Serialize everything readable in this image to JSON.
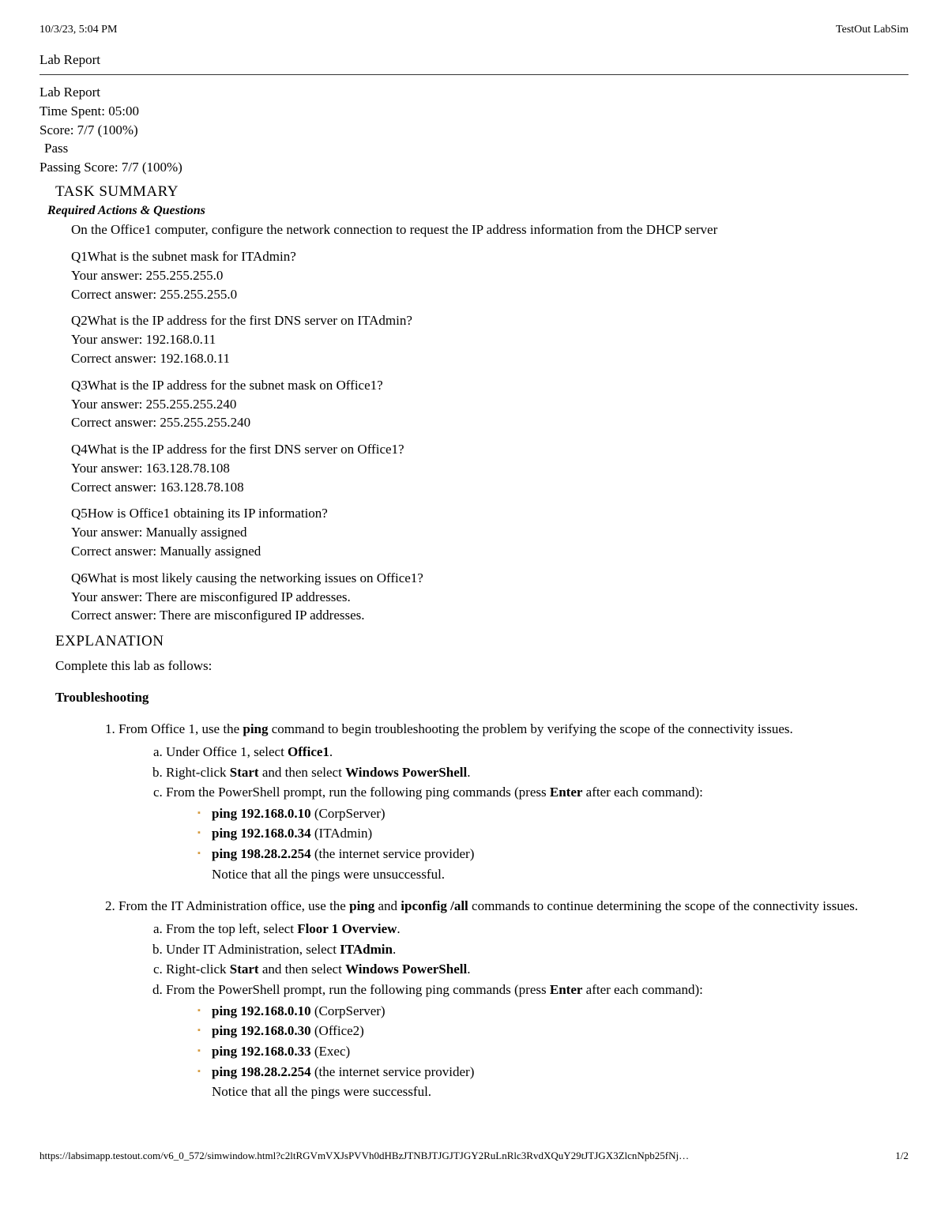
{
  "header": {
    "datetime": "10/3/23, 5:04 PM",
    "app_title": "TestOut LabSim"
  },
  "title": "Lab Report",
  "summary": {
    "title": "Lab Report",
    "time_spent": "Time Spent: 05:00",
    "score": "Score: 7/7 (100%)",
    "status": "Pass",
    "passing_score": "Passing Score: 7/7 (100%)"
  },
  "task_summary_title": "TASK SUMMARY",
  "required_title": "Required Actions & Questions",
  "action1": "On the Office1 computer, configure the network connection to request the IP address information from the DHCP server",
  "questions": [
    {
      "q": "Q1What is the subnet mask for ITAdmin?",
      "your": "Your answer: 255.255.255.0",
      "correct": "Correct answer: 255.255.255.0"
    },
    {
      "q": "Q2What is the IP address for the first DNS server on ITAdmin?",
      "your": "Your answer: 192.168.0.11",
      "correct": "Correct answer: 192.168.0.11"
    },
    {
      "q": "Q3What is the IP address for the subnet mask on Office1?",
      "your": "Your answer: 255.255.255.240",
      "correct": "Correct answer: 255.255.255.240"
    },
    {
      "q": "Q4What is the IP address for the first DNS server on Office1?",
      "your": "Your answer: 163.128.78.108",
      "correct": "Correct answer: 163.128.78.108"
    },
    {
      "q": "Q5How is Office1 obtaining its IP information?",
      "your": "Your answer: Manually assigned",
      "correct": "Correct answer: Manually assigned"
    },
    {
      "q": "Q6What is most likely causing the networking issues on Office1?",
      "your": "Your answer: There are misconfigured IP addresses.",
      "correct": "Correct answer: There are misconfigured IP addresses."
    }
  ],
  "explanation_title": "EXPLANATION",
  "explanation_intro": "Complete this lab as follows:",
  "troubleshooting_title": "Troubleshooting",
  "step1": {
    "text_pre": "From Office 1, use the ",
    "bold1": "ping",
    "text_post": " command to begin troubleshooting the problem by verifying the scope of the connectivity issues.",
    "a_pre": "Under Office 1, select ",
    "a_bold": "Office1",
    "a_post": ".",
    "b_pre": "Right-click ",
    "b_bold1": "Start",
    "b_mid": " and then select ",
    "b_bold2": "Windows PowerShell",
    "b_post": ".",
    "c_pre": "From the PowerShell prompt, run the following ping commands (press ",
    "c_bold": "Enter",
    "c_post": " after each command):",
    "bullet1_bold": "ping 192.168.0.10",
    "bullet1_post": " (CorpServer)",
    "bullet2_bold": "ping 192.168.0.34",
    "bullet2_post": " (ITAdmin)",
    "bullet3_bold": "ping 198.28.2.254",
    "bullet3_post": " (the internet service provider)",
    "note": "Notice that all the pings were unsuccessful."
  },
  "step2": {
    "text_pre": "From the IT Administration office, use the ",
    "bold1": "ping",
    "text_mid": " and ",
    "bold2": "ipconfig /all",
    "text_post": " commands to continue determining the scope of the connectivity issues.",
    "a_pre": "From the top left, select ",
    "a_bold": "Floor 1 Overview",
    "a_post": ".",
    "b_pre": "Under IT Administration, select ",
    "b_bold": "ITAdmin",
    "b_post": ".",
    "c_pre": "Right-click ",
    "c_bold1": "Start",
    "c_mid": " and then select ",
    "c_bold2": "Windows PowerShell",
    "c_post": ".",
    "d_pre": "From the PowerShell prompt, run the following ping commands (press ",
    "d_bold": "Enter",
    "d_post": " after each command):",
    "bullet1_bold": "ping 192.168.0.10",
    "bullet1_post": " (CorpServer)",
    "bullet2_bold": "ping 192.168.0.30",
    "bullet2_post": " (Office2)",
    "bullet3_bold": "ping 192.168.0.33",
    "bullet3_post": " (Exec)",
    "bullet4_bold": "ping 198.28.2.254",
    "bullet4_post": " (the internet service provider)",
    "note": "Notice that all the pings were successful."
  },
  "footer": {
    "url": "https://labsimapp.testout.com/v6_0_572/simwindow.html?c2ltRGVmVXJsPVVh0dHBzJTNBJTJGJTJGY2RuLnRlc3RvdXQuY29tJTJGX3ZlcnNpb25fNj…",
    "page": "1/2"
  }
}
